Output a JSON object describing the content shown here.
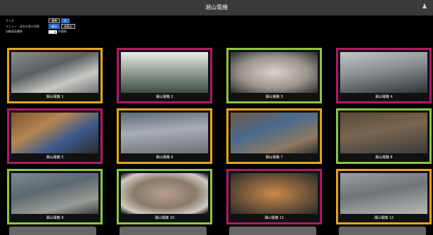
{
  "header": {
    "title": "湘山電機",
    "user_icon": "user-icon"
  },
  "settings": {
    "rows": [
      {
        "label": "サイズ",
        "options": [
          "標準",
          "大"
        ]
      },
      {
        "label": "メニュー・再生の表示切替",
        "options": [
          "表示",
          "非表示"
        ]
      },
      {
        "label": "自動画面遷移",
        "select_value": "",
        "suffix": "秒間隔"
      }
    ]
  },
  "colors": {
    "orange": "#e8a417",
    "magenta": "#b01966",
    "green": "#8cc63f",
    "accent": "#2f6fd1"
  },
  "cameras": [
    {
      "label": "湘山電機 1",
      "border": "orange"
    },
    {
      "label": "湘山電機 2",
      "border": "magenta"
    },
    {
      "label": "湘山電機 3",
      "border": "green"
    },
    {
      "label": "湘山電機 4",
      "border": "magenta"
    },
    {
      "label": "湘山電機 5",
      "border": "magenta"
    },
    {
      "label": "湘山電機 6",
      "border": "orange"
    },
    {
      "label": "湘山電機 7",
      "border": "orange"
    },
    {
      "label": "湘山電機 8",
      "border": "green"
    },
    {
      "label": "湘山電機 9",
      "border": "green"
    },
    {
      "label": "湘山電機 10",
      "border": "green"
    },
    {
      "label": "湘山電機 11",
      "border": "magenta"
    },
    {
      "label": "湘山電機 12",
      "border": "orange"
    }
  ]
}
